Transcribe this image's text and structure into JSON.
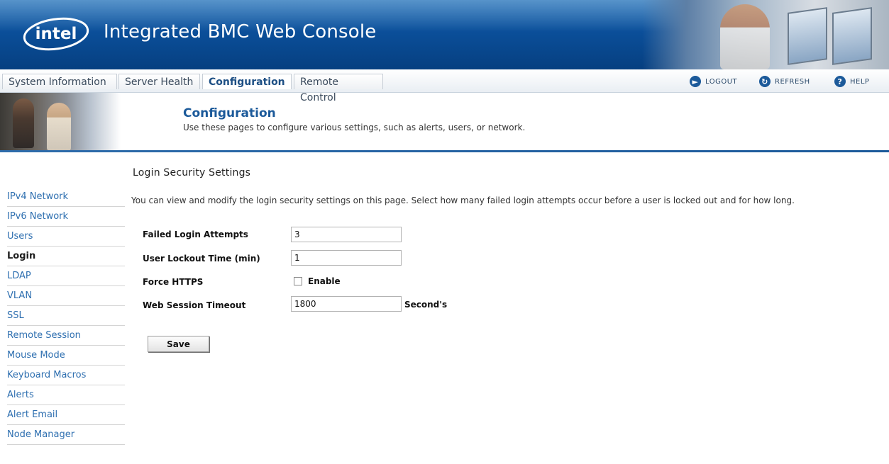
{
  "app": {
    "brand": "intel",
    "title": "Integrated BMC Web Console"
  },
  "nav": {
    "tabs": [
      {
        "label": "System Information"
      },
      {
        "label": "Server Health"
      },
      {
        "label": "Configuration",
        "active": true
      },
      {
        "label": "Remote Control"
      }
    ],
    "utilities": [
      {
        "label": "LOGOUT",
        "icon": "logout-icon"
      },
      {
        "label": "REFRESH",
        "icon": "refresh-icon"
      },
      {
        "label": "HELP",
        "icon": "help-icon"
      }
    ]
  },
  "section": {
    "title": "Configuration",
    "description": "Use these pages to configure various settings, such as alerts, users, or network."
  },
  "sidebar": {
    "items": [
      {
        "label": "IPv4 Network"
      },
      {
        "label": "IPv6 Network"
      },
      {
        "label": "Users"
      },
      {
        "label": "Login",
        "active": true
      },
      {
        "label": "LDAP"
      },
      {
        "label": "VLAN"
      },
      {
        "label": "SSL"
      },
      {
        "label": "Remote Session"
      },
      {
        "label": "Mouse Mode"
      },
      {
        "label": "Keyboard Macros"
      },
      {
        "label": "Alerts"
      },
      {
        "label": "Alert Email"
      },
      {
        "label": "Node Manager"
      }
    ]
  },
  "page": {
    "title": "Login Security Settings",
    "description": "You can view and modify the login security settings on this page. Select how many failed login attempts occur before a user is locked out and for how long."
  },
  "form": {
    "failed_attempts": {
      "label": "Failed Login Attempts",
      "value": "3"
    },
    "lockout_time": {
      "label": "User Lockout Time (min)",
      "value": "1"
    },
    "force_https": {
      "label": "Force HTTPS",
      "checkbox_label": "Enable",
      "checked": false
    },
    "session_timeout": {
      "label": "Web Session Timeout",
      "value": "1800",
      "unit": "Second's"
    },
    "save_label": "Save"
  },
  "colors": {
    "banner": "#0b4f9a",
    "accent": "#1c5a9a",
    "link": "#2e6fb0"
  }
}
